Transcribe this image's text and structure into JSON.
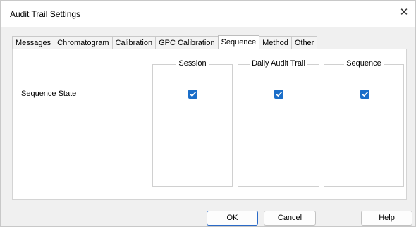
{
  "window": {
    "title": "Audit Trail Settings"
  },
  "tabs": [
    {
      "label": "Messages"
    },
    {
      "label": "Chromatogram"
    },
    {
      "label": "Calibration"
    },
    {
      "label": "GPC Calibration"
    },
    {
      "label": "Sequence",
      "active": true
    },
    {
      "label": "Method"
    },
    {
      "label": "Other"
    }
  ],
  "panel": {
    "row_label": "Sequence State",
    "groups": [
      {
        "title": "Session",
        "checked": true
      },
      {
        "title": "Daily Audit Trail",
        "checked": true
      },
      {
        "title": "Sequence",
        "checked": true
      }
    ]
  },
  "buttons": {
    "ok": "OK",
    "cancel": "Cancel",
    "help": "Help"
  },
  "colors": {
    "accent": "#1a6ec9",
    "default_button_border": "#2a6ac7"
  },
  "icons": {
    "close": "close-icon",
    "check": "checkmark-icon"
  }
}
